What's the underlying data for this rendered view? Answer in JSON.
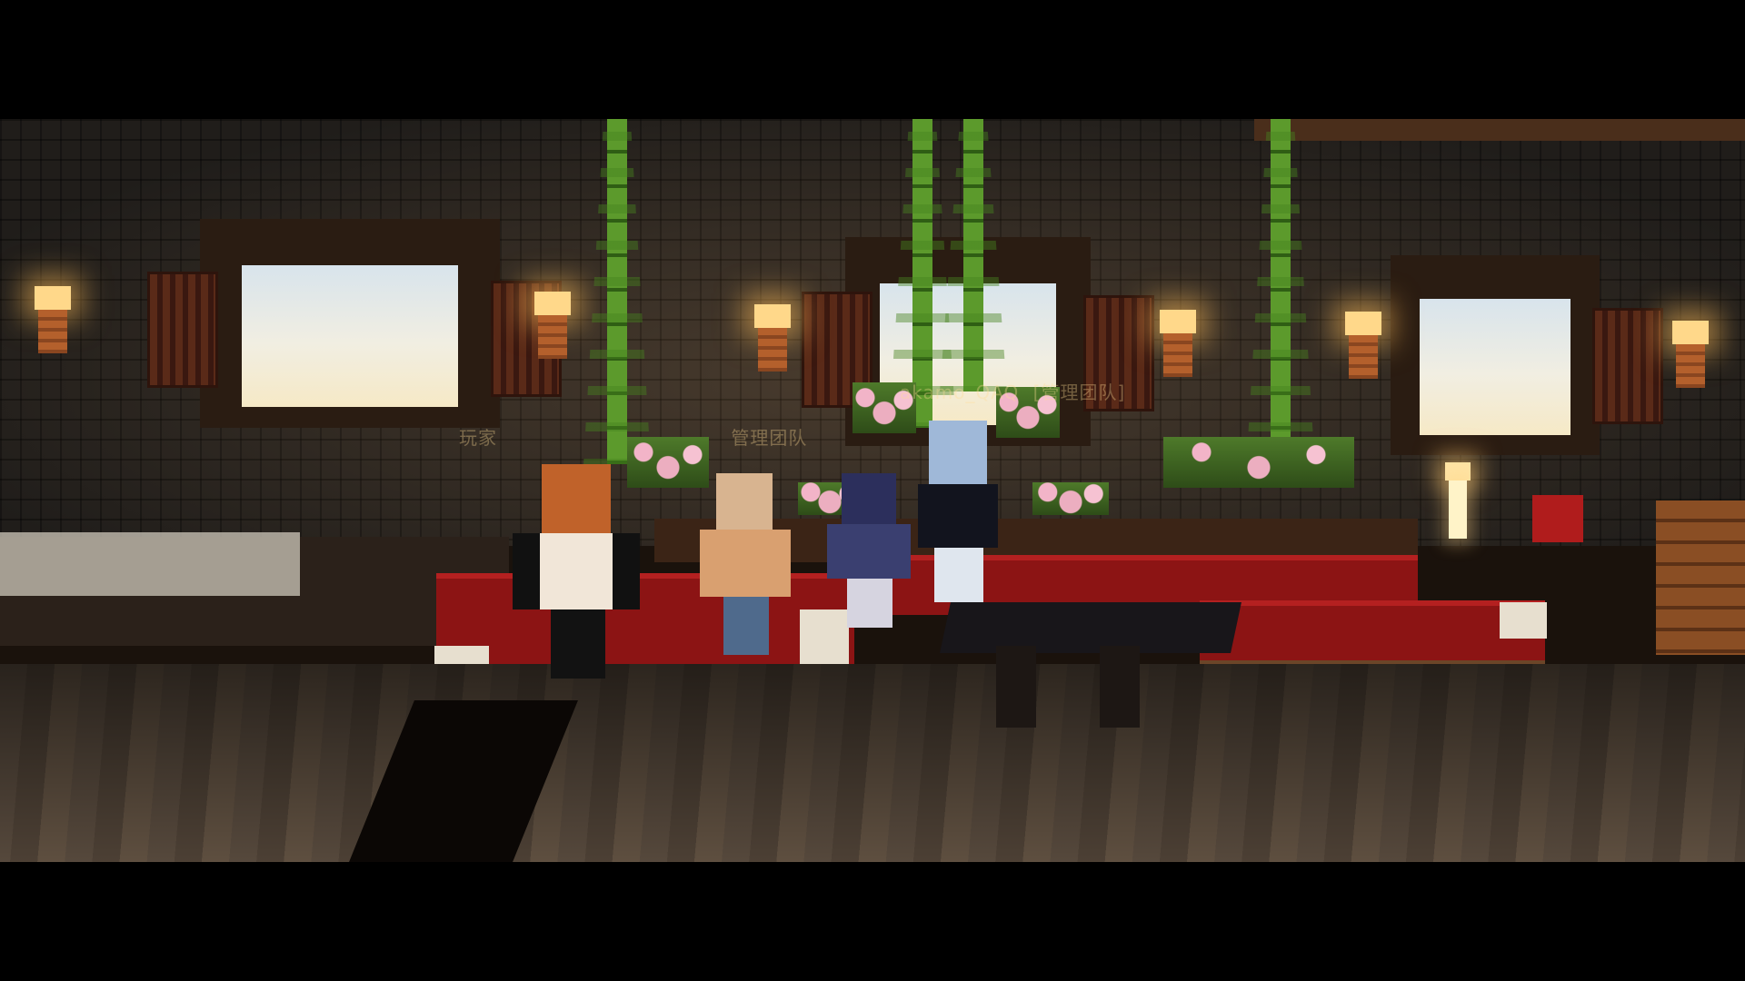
{
  "scene": {
    "type": "minecraft-interior-lounge",
    "letterbox": true
  },
  "nametags": {
    "left_prefix": "玩家",
    "left_team": "管理团队",
    "right_name": "akamo_QAQ",
    "right_team": "[管理团队]"
  },
  "players": [
    {
      "name": "player-orange-hair",
      "color": "#c0622a"
    },
    {
      "name": "player-cream-hoodie",
      "color": "#d9a070"
    },
    {
      "name": "player-navy-outfit",
      "color": "#2c2f5c"
    },
    {
      "name": "player-blue-hair",
      "color": "#9fb8d8"
    }
  ],
  "colors": {
    "cushion": "#8c1414",
    "lantern_glow": "#ffd88a",
    "bamboo": "#5c9a2c"
  }
}
